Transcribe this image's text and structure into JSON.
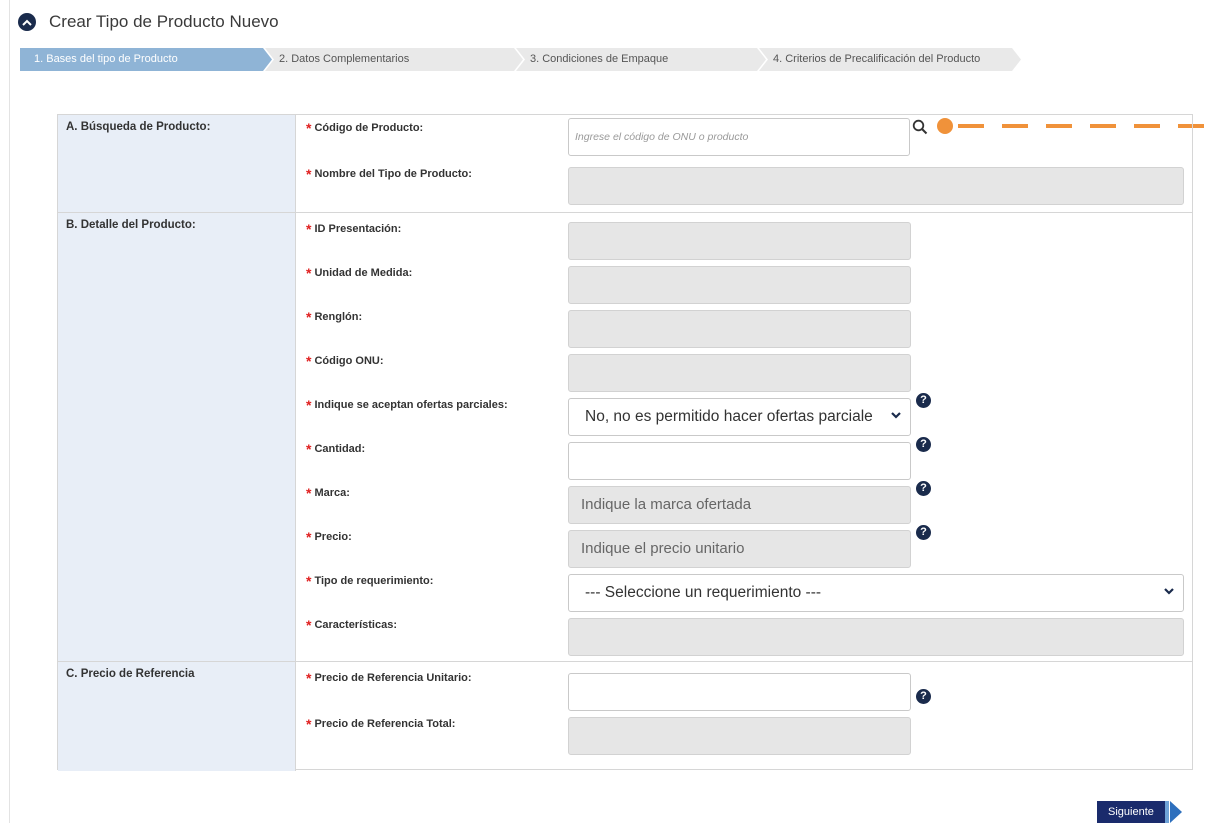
{
  "page": {
    "title": "Crear Tipo de Producto Nuevo"
  },
  "steps": [
    {
      "label": "1. Bases del tipo de Producto",
      "active": true
    },
    {
      "label": "2. Datos Complementarios",
      "active": false
    },
    {
      "label": "3. Condiciones de Empaque",
      "active": false
    },
    {
      "label": "4. Criterios de Precalificación del Producto",
      "active": false
    }
  ],
  "sections": {
    "busqueda": {
      "label": "A. Búsqueda de Producto:",
      "codigo_label": "Código de Producto:",
      "codigo_placeholder": "Ingrese el código de ONU o producto",
      "nombre_label": "Nombre del Tipo de Producto:"
    },
    "detalle": {
      "label": "B. Detalle del Producto:",
      "id_presentacion_label": "ID Presentación:",
      "unidad_label": "Unidad de Medida:",
      "renglon_label": "Renglón:",
      "codigo_onu_label": "Código ONU:",
      "ofertas_label": "Indique se aceptan ofertas parciales:",
      "ofertas_value": "No, no es permitido hacer ofertas parciale",
      "cantidad_label": "Cantidad:",
      "marca_label": "Marca:",
      "marca_placeholder": "Indique la marca ofertada",
      "precio_label": "Precio:",
      "precio_placeholder": "Indique el precio unitario",
      "tipo_req_label": "Tipo de requerimiento:",
      "tipo_req_value": "--- Seleccione un requerimiento ---",
      "caracteristicas_label": "Características:"
    },
    "referencia": {
      "label": "C. Precio de Referencia",
      "unitario_label": "Precio de Referencia Unitario:",
      "total_label": "Precio de Referencia Total:"
    }
  },
  "required_marker": "*",
  "help_glyph": "?",
  "buttons": {
    "next_label": "Siguiente"
  },
  "colors": {
    "accent": "#1a2b4c",
    "step_active": "#8fb4d6",
    "annotation": "#f0923a",
    "required": "#e02020"
  }
}
